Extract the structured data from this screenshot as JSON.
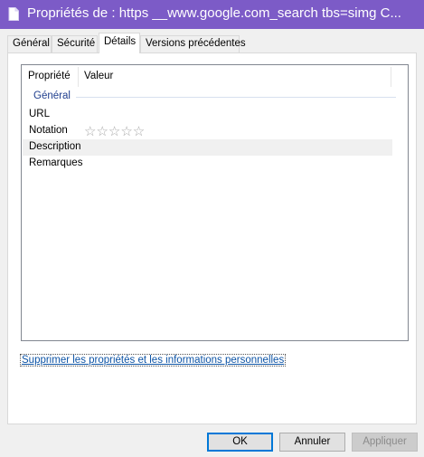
{
  "window": {
    "title": "Propriétés de : https __www.google.com_search tbs=simg C..."
  },
  "tabs": [
    {
      "label": "Général"
    },
    {
      "label": "Sécurité"
    },
    {
      "label": "Détails"
    },
    {
      "label": "Versions précédentes"
    }
  ],
  "details": {
    "columns": {
      "property": "Propriété",
      "value": "Valeur"
    },
    "group": "Général",
    "rows": [
      {
        "label": "URL"
      },
      {
        "label": "Notation",
        "rating": "☆☆☆☆☆"
      },
      {
        "label": "Description"
      },
      {
        "label": "Remarques"
      }
    ]
  },
  "link": "Supprimer les propriétés et les informations personnelles",
  "buttons": {
    "ok": "OK",
    "cancel": "Annuler",
    "apply": "Appliquer"
  },
  "colors": {
    "titlebar": "#7c5bc7",
    "group_label": "#1f3e8e",
    "link": "#0d54a6",
    "default_button_border": "#0078d7"
  },
  "icons": {
    "title": "document-icon",
    "rating": "star-icon"
  }
}
